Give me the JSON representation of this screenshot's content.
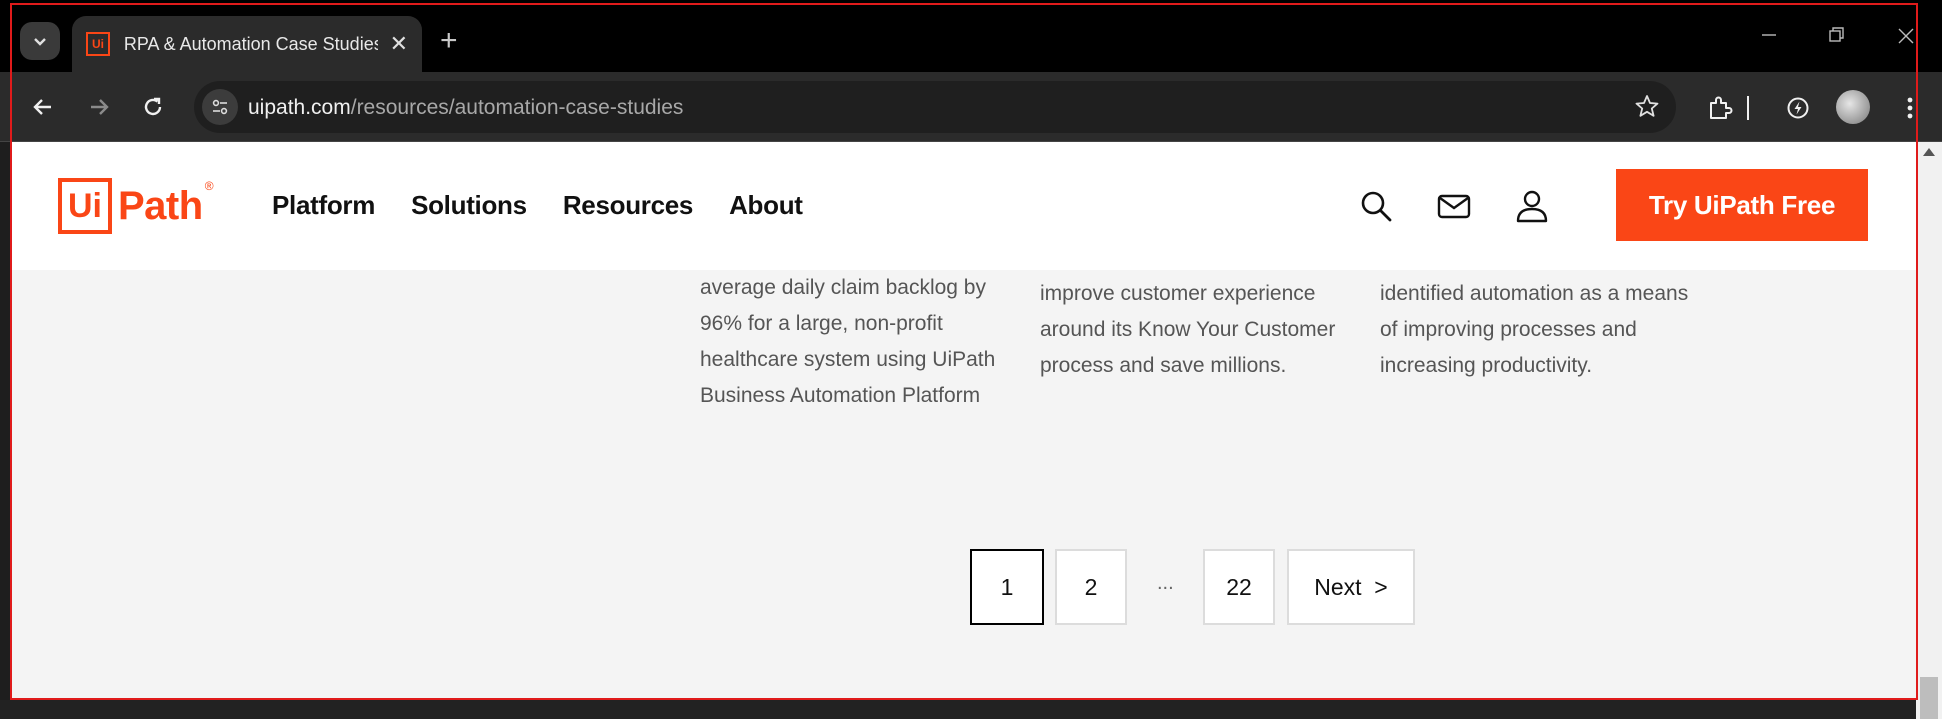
{
  "browser": {
    "tab_title": "RPA & Automation Case Studies",
    "favicon_text": "Ui",
    "url_host": "uipath.com",
    "url_path": "/resources/automation-case-studies"
  },
  "header": {
    "logo_box": "Ui",
    "logo_text": "Path",
    "logo_reg": "®",
    "nav": [
      "Platform",
      "Solutions",
      "Resources",
      "About"
    ],
    "cta": "Try UiPath Free"
  },
  "cards": [
    {
      "text": "average daily claim backlog by 96% for a large, non-profit healthcare system using UiPath Business Automation Platform"
    },
    {
      "text": "improve customer experience around its Know Your Customer process and save millions."
    },
    {
      "text": "identified automation as a means of improving processes and increasing productivity."
    }
  ],
  "pagination": {
    "pages": [
      "1",
      "2",
      "22"
    ],
    "ellipsis": "...",
    "next": "Next  >",
    "current": "1"
  },
  "colors": {
    "brand": "#fa4616",
    "page_bg": "#f4f4f4",
    "frame": "#e01b1b"
  }
}
